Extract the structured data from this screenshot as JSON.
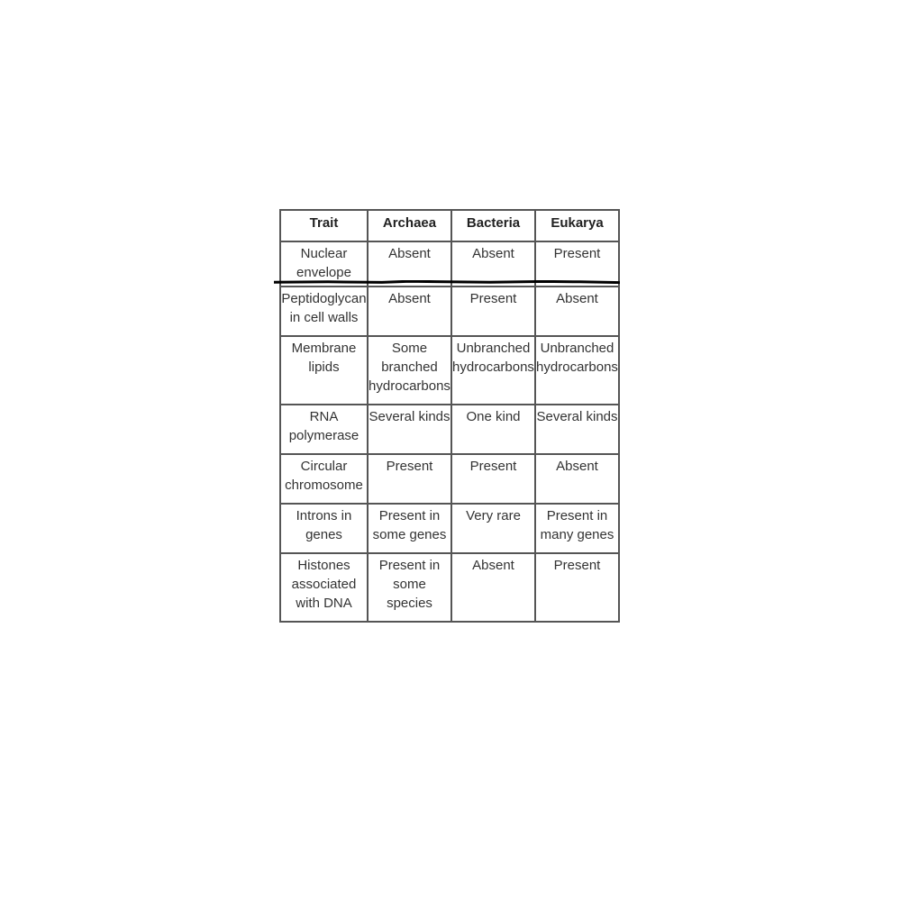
{
  "table": {
    "headers": [
      "Trait",
      "Archaea",
      "Bacteria",
      "Eukarya"
    ],
    "rows": [
      [
        "Nuclear envelope",
        "Absent",
        "Absent",
        "Present"
      ],
      [
        "Peptidoglycan in cell walls",
        "Absent",
        "Present",
        "Absent"
      ],
      [
        "Membrane lipids",
        "Some branched hydrocarbons",
        "Unbranched hydrocarbons",
        "Unbranched hydrocarbons"
      ],
      [
        "RNA polymerase",
        "Several kinds",
        "One kind",
        "Several kinds"
      ],
      [
        "Circular chromosome",
        "Present",
        "Present",
        "Absent"
      ],
      [
        "Introns in genes",
        "Present in some genes",
        "Very rare",
        "Present in many genes"
      ],
      [
        "Histones associated with DNA",
        "Present in some species",
        "Absent",
        "Present"
      ]
    ]
  },
  "annotation": {
    "type": "hand-drawn-line",
    "color": "#000000",
    "description": "black marker line drawn between row 'Nuclear envelope' and row 'Peptidoglycan in cell walls'"
  }
}
